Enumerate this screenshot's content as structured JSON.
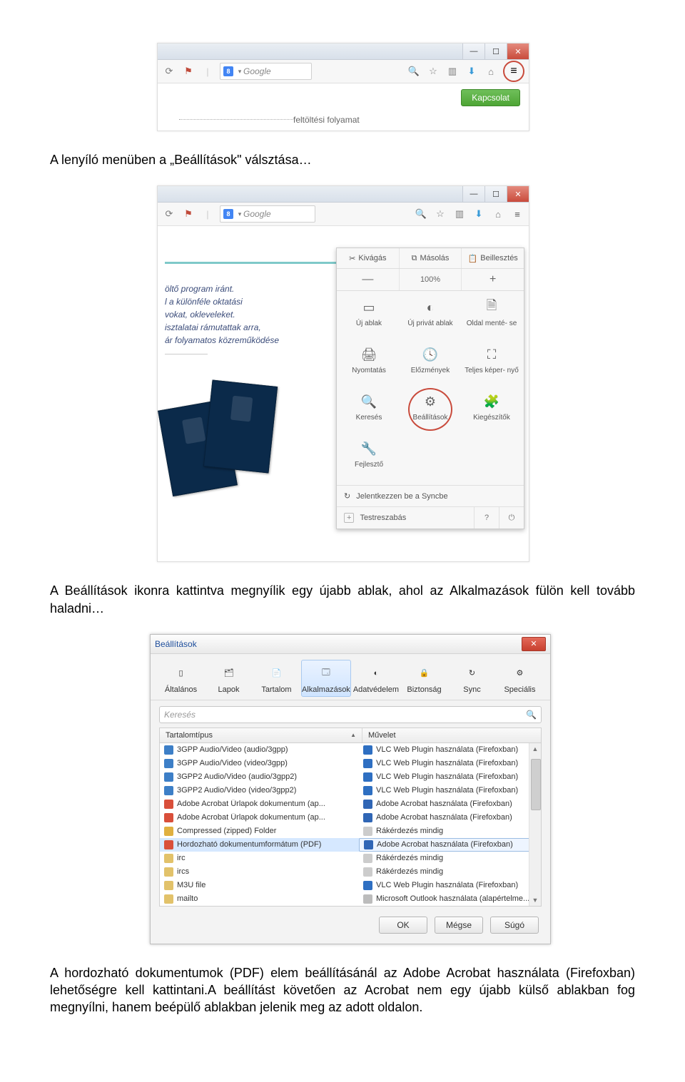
{
  "shot1": {
    "search_engine": "8",
    "search_placeholder": "Google",
    "kapcsolat": "Kapcsolat",
    "upload_text": "feltöltési folyamat"
  },
  "para1": "A lenyíló menüben a „Beállítások\" válsztása…",
  "shot2": {
    "snippet_lines": [
      "öltő program iránt.",
      "l a különféle oktatási",
      "vokat, okleveleket.",
      "isztalatai rámutattak arra,",
      "ár folyamatos közreműködése"
    ],
    "search_placeholder": "Google",
    "top_actions": [
      "Kivágás",
      "Másolás",
      "Beillesztés"
    ],
    "zoom": {
      "minus": "—",
      "value": "100%",
      "plus": "+"
    },
    "grid": [
      {
        "label": "Új ablak"
      },
      {
        "label": "Új privát ablak"
      },
      {
        "label": "Oldal menté-\nse"
      },
      {
        "label": "Nyomtatás"
      },
      {
        "label": "Előzmények"
      },
      {
        "label": "Teljes képer-\nnyő"
      },
      {
        "label": "Keresés"
      },
      {
        "label": "Beállítások",
        "circled": true
      },
      {
        "label": "Kiegészítők"
      },
      {
        "label": "Fejlesztő"
      }
    ],
    "sync_row": "Jelentkezzen be a Syncbe",
    "customize": "Testreszabás"
  },
  "para2": "A Beállítások ikonra kattintva megnyílik egy újabb ablak, ahol az Alkalmazások fülön kell tovább haladni…",
  "shot3": {
    "title": "Beállítások",
    "tabs": [
      "Általános",
      "Lapok",
      "Tartalom",
      "Alkalmazások",
      "Adatvédelem",
      "Biztonság",
      "Sync",
      "Speciális"
    ],
    "active_tab_index": 3,
    "search_placeholder": "Keresés",
    "col1": "Tartalomtípus",
    "col2": "Művelet",
    "rows": [
      {
        "t": "3GPP Audio/Video (audio/3gpp)",
        "ti": "mi-media",
        "a": "VLC Web Plugin használata (Firefoxban)",
        "ai": "mi-vlc"
      },
      {
        "t": "3GPP Audio/Video (video/3gpp)",
        "ti": "mi-media",
        "a": "VLC Web Plugin használata (Firefoxban)",
        "ai": "mi-vlc"
      },
      {
        "t": "3GPP2 Audio/Video (audio/3gpp2)",
        "ti": "mi-media",
        "a": "VLC Web Plugin használata (Firefoxban)",
        "ai": "mi-vlc"
      },
      {
        "t": "3GPP2 Audio/Video (video/3gpp2)",
        "ti": "mi-media",
        "a": "VLC Web Plugin használata (Firefoxban)",
        "ai": "mi-vlc"
      },
      {
        "t": "Adobe Acrobat Űrlapok dokumentum (ap...",
        "ti": "mi-pdf",
        "a": "Adobe Acrobat használata (Firefoxban)",
        "ai": "mi-acro"
      },
      {
        "t": "Adobe Acrobat Űrlapok dokumentum (ap...",
        "ti": "mi-pdf",
        "a": "Adobe Acrobat használata (Firefoxban)",
        "ai": "mi-acro"
      },
      {
        "t": "Compressed (zipped) Folder",
        "ti": "mi-zip",
        "a": "Rákérdezés mindig",
        "ai": "mi-q"
      },
      {
        "t": "Hordozható dokumentumformátum (PDF)",
        "ti": "mi-pdf",
        "a": "Adobe Acrobat használata (Firefoxban)",
        "ai": "mi-acro",
        "sel": true
      },
      {
        "t": "irc",
        "ti": "mi-folder",
        "a": "Rákérdezés mindig",
        "ai": "mi-q"
      },
      {
        "t": "ircs",
        "ti": "mi-folder",
        "a": "Rákérdezés mindig",
        "ai": "mi-q"
      },
      {
        "t": "M3U file",
        "ti": "mi-folder",
        "a": "VLC Web Plugin használata (Firefoxban)",
        "ai": "mi-vlc"
      },
      {
        "t": "mailto",
        "ti": "mi-folder",
        "a": "Microsoft Outlook használata (alapértelme...",
        "ai": "mi-out"
      }
    ],
    "buttons": [
      "OK",
      "Mégse",
      "Súgó"
    ]
  },
  "para3": "A hordozható dokumentumok (PDF) elem beállításánál az Adobe Acrobat használata (Firefoxban) lehetőségre kell kattintani.A beállítást követően az Acrobat nem egy újabb külső ablakban fog megnyílni, hanem beépülő ablakban jelenik meg az adott oldalon."
}
